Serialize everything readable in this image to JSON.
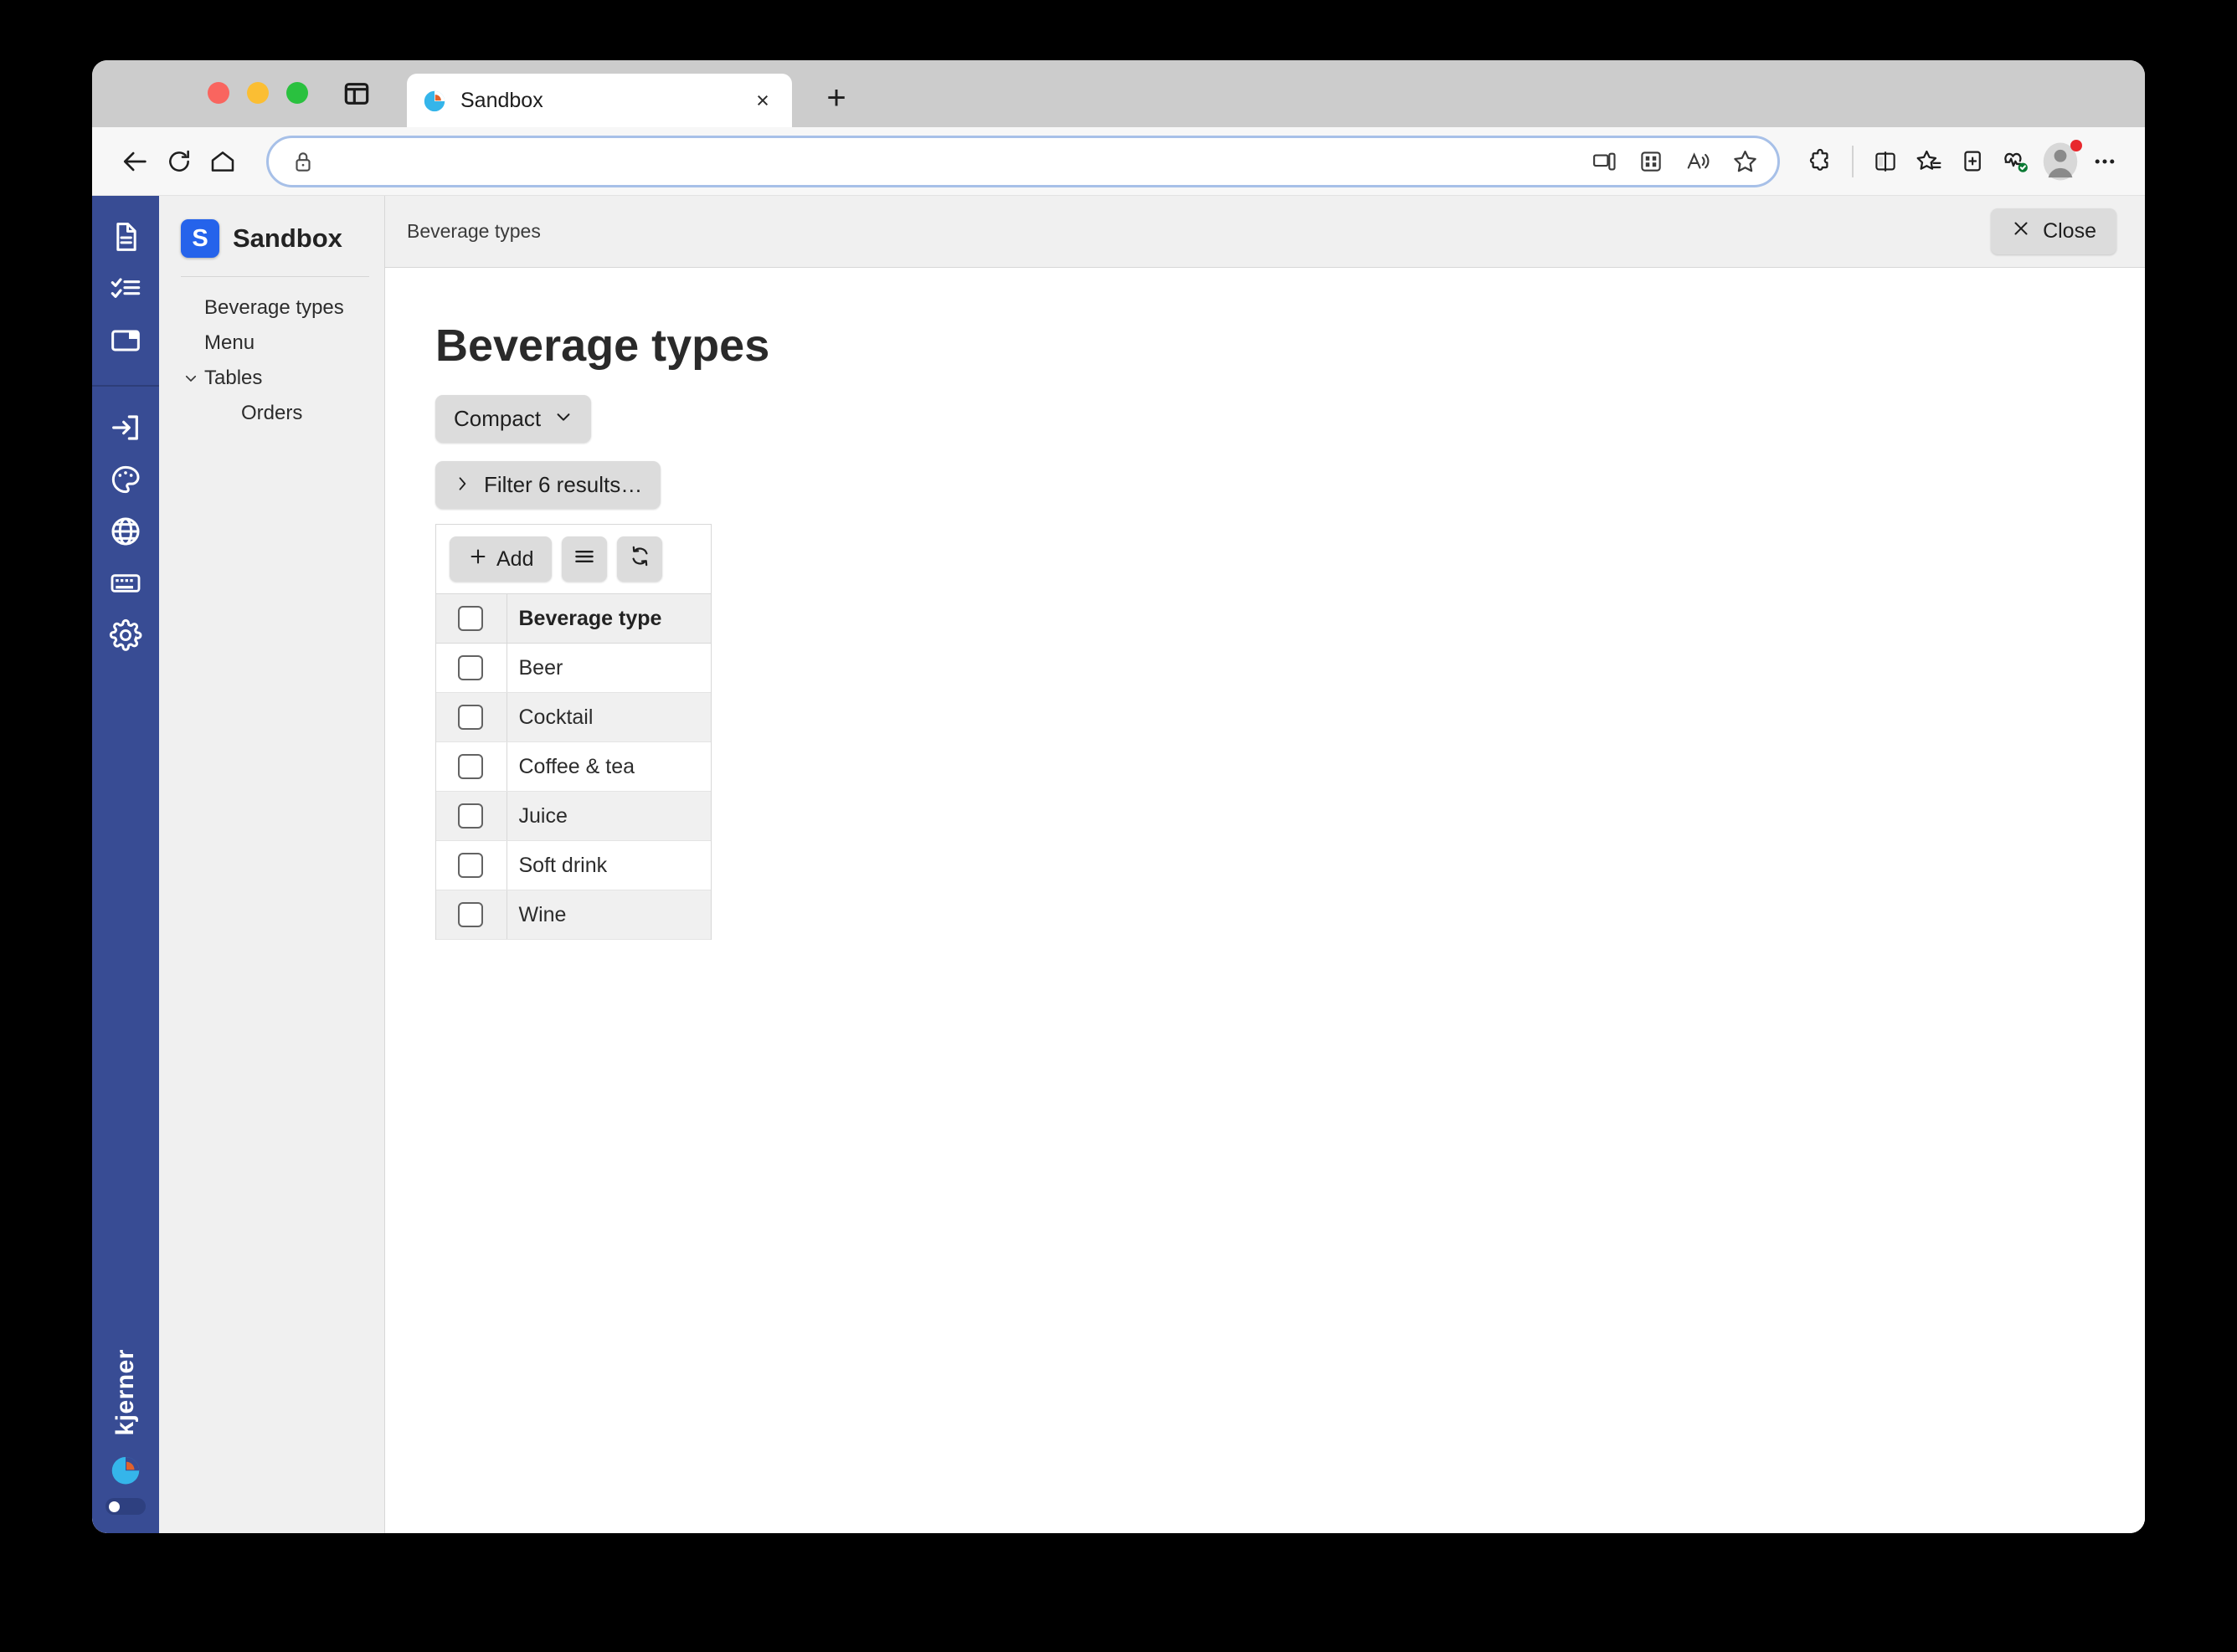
{
  "browser": {
    "traffic_lights": [
      "close",
      "minimize",
      "maximize"
    ],
    "pane_toggle_icon": "sidebar-toggle-icon",
    "tab": {
      "title": "Sandbox",
      "favicon": "pie-chart-favicon",
      "close_label": "×"
    },
    "new_tab_label": "+",
    "nav": {
      "back_icon": "back-arrow-icon",
      "reload_icon": "reload-icon",
      "home_icon": "home-icon"
    },
    "address_bar": {
      "lock_icon": "lock-icon",
      "url": "",
      "placeholder": ""
    },
    "omnibox_actions": [
      "cast-to-device-icon",
      "split-screen-apps-icon",
      "read-aloud-icon",
      "add-favorite-icon"
    ],
    "toolbar_actions": [
      "extensions-icon",
      "split-screen-icon",
      "favorites-icon",
      "collections-icon",
      "browser-essentials-icon"
    ],
    "profile": {
      "avatar_icon": "profile-avatar-icon",
      "badge_color": "#e8282d"
    },
    "more_icon": "more-options-icon"
  },
  "rail": {
    "background": "#384c94",
    "top_icons": [
      {
        "name": "document-icon",
        "label": "Documents"
      },
      {
        "name": "checklist-icon",
        "label": "Tasks"
      },
      {
        "name": "folder-icon",
        "label": "Folders"
      }
    ],
    "bottom_icons": [
      {
        "name": "sign-in-icon",
        "label": "Sign in"
      },
      {
        "name": "palette-icon",
        "label": "Theme"
      },
      {
        "name": "globe-icon",
        "label": "Language"
      },
      {
        "name": "keyboard-icon",
        "label": "Keyboard shortcuts"
      },
      {
        "name": "gear-icon",
        "label": "Settings"
      }
    ],
    "brand_text": "kjerner",
    "brand_logo": "pie-chart-logo",
    "toggle_state": "on"
  },
  "nav_panel": {
    "app_badge_letter": "S",
    "app_name": "Sandbox",
    "badge_color": "#2563eb",
    "items": [
      {
        "label": "Beverage types",
        "level": 0,
        "caret": ""
      },
      {
        "label": "Menu",
        "level": 0,
        "caret": ""
      },
      {
        "label": "Tables",
        "level": 0,
        "caret": "expanded"
      },
      {
        "label": "Orders",
        "level": 1,
        "caret": ""
      }
    ]
  },
  "header": {
    "breadcrumb": "Beverage types",
    "close_label": "Close",
    "close_icon": "close-x-icon"
  },
  "main": {
    "title": "Beverage types",
    "density_button": {
      "label": "Compact",
      "caret_icon": "chevron-down-icon"
    },
    "filter_button": {
      "label": "Filter 6 results…",
      "caret_icon": "chevron-right-icon"
    },
    "table_toolbar": {
      "add_label": "Add",
      "add_icon": "plus-icon",
      "menu_icon": "hamburger-menu-icon",
      "refresh_icon": "refresh-icon"
    },
    "table": {
      "columns": [
        "Beverage type"
      ],
      "select_all_checkbox": false,
      "rows": [
        {
          "name": "Beer",
          "selected": false
        },
        {
          "name": "Cocktail",
          "selected": false
        },
        {
          "name": "Coffee & tea",
          "selected": false
        },
        {
          "name": "Juice",
          "selected": false
        },
        {
          "name": "Soft drink",
          "selected": false
        },
        {
          "name": "Wine",
          "selected": false
        }
      ]
    }
  }
}
